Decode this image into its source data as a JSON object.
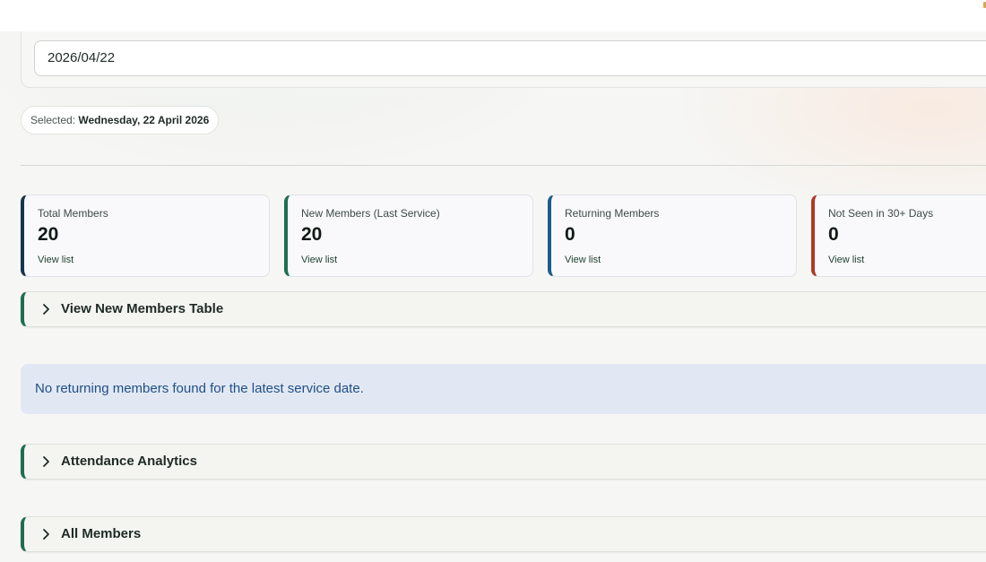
{
  "date_input": {
    "value": "2026/04/22"
  },
  "selected": {
    "prefix": "Selected:",
    "value": "Wednesday, 22 April 2026"
  },
  "stats": [
    {
      "label": "Total Members",
      "value": "20",
      "link": "View list",
      "accent": "#14364f"
    },
    {
      "label": "New Members (Last Service)",
      "value": "20",
      "link": "View list",
      "accent": "#1f6e4f"
    },
    {
      "label": "Returning Members",
      "value": "0",
      "link": "View list",
      "accent": "#1a5d8c"
    },
    {
      "label": "Not Seen in 30+ Days",
      "value": "0",
      "link": "View list",
      "accent": "#b03a22"
    }
  ],
  "expanders": {
    "new_members": "View New Members Table",
    "analytics": "Attendance Analytics",
    "all_members": "All Members"
  },
  "info_message": "No returning members found for the latest service date.",
  "colors": {
    "expander_accent": "#1f6e4f",
    "info_background": "#e2e8f3",
    "info_text": "#1f4f87"
  },
  "icons": {
    "expander": "chevron-right-icon"
  }
}
